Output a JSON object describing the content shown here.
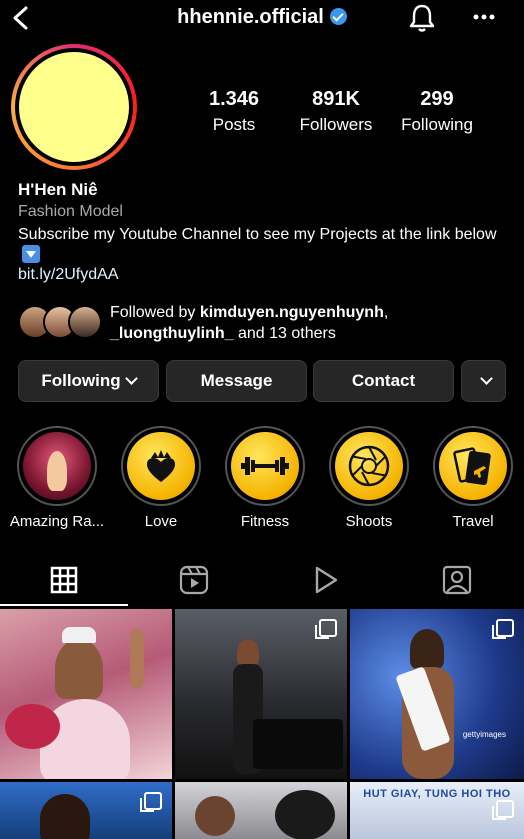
{
  "header": {
    "username": "hhennie.official"
  },
  "profile": {
    "stats": [
      {
        "value": "1.346",
        "label": "Posts"
      },
      {
        "value": "891K",
        "label": "Followers"
      },
      {
        "value": "299",
        "label": "Following"
      }
    ],
    "name": "H'Hen Niê",
    "category": "Fashion Model",
    "bio": "Subscribe my Youtube Channel to see my Projects at the link below",
    "link": "bit.ly/2UfydAA"
  },
  "followed_by": {
    "prefix": "Followed by ",
    "user1": "kimduyen.nguyenhuynh",
    "sep": ",",
    "user2": "_luongthuylinh_",
    "suffix": " and 13 others"
  },
  "buttons": {
    "following": "Following",
    "message": "Message",
    "contact": "Contact"
  },
  "highlights": [
    {
      "label": "Amazing Ra...",
      "icon": "photo"
    },
    {
      "label": "Love",
      "icon": "crown-heart-icon"
    },
    {
      "label": "Fitness",
      "icon": "dumbbell-icon"
    },
    {
      "label": "Shoots",
      "icon": "aperture-icon"
    },
    {
      "label": "Travel",
      "icon": "passport-icon"
    }
  ],
  "tabs": [
    "grid-icon",
    "reels-icon",
    "video-play-icon",
    "tagged-icon"
  ],
  "posts": {
    "watermark": "gettyimages",
    "banner": "HUT GIAY, TUNG HOI THO"
  },
  "colors": {
    "background": "#000000",
    "button": "#262626",
    "verified": "#3897f0",
    "avatar": "#ffff8c"
  }
}
